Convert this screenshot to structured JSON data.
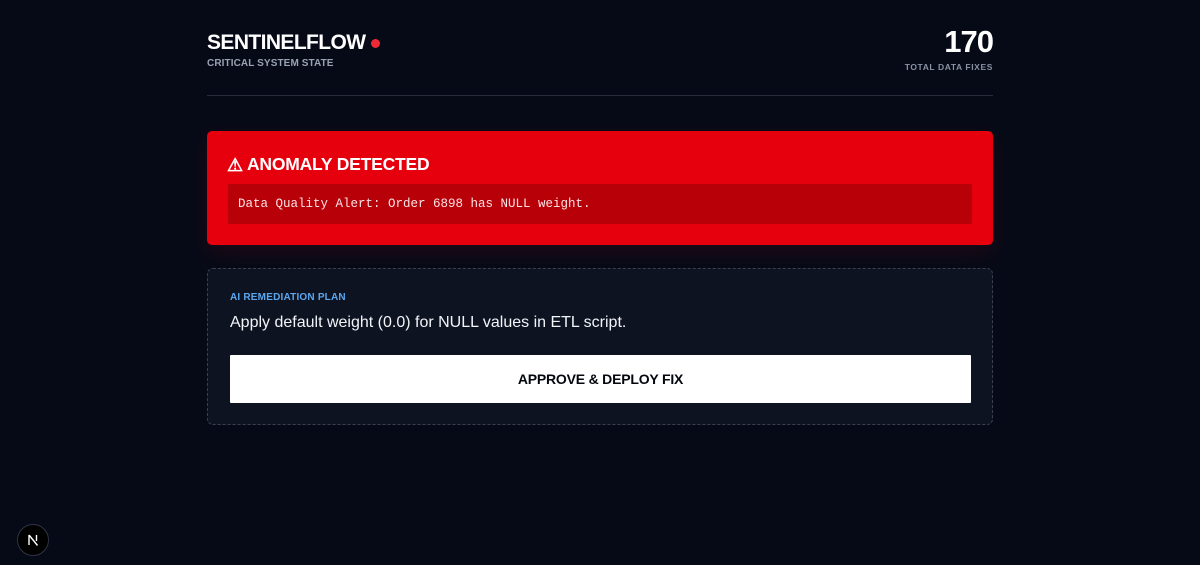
{
  "header": {
    "brand_name": "SENTINELFLOW",
    "brand_subtitle": "CRITICAL SYSTEM STATE",
    "status_dot_color": "#ef2a36",
    "total_fixes_value": "170",
    "total_fixes_label": "TOTAL DATA FIXES"
  },
  "alert": {
    "icon": "warning-icon",
    "icon_glyph": "⚠",
    "title": "ANOMALY DETECTED",
    "message": "Data Quality Alert: Order 6898 has NULL weight.",
    "accent_color": "#e6000d"
  },
  "plan": {
    "label": "AI REMEDIATION PLAN",
    "text": "Apply default weight (0.0) for NULL values in ETL script.",
    "button_label": "APPROVE & DEPLOY FIX",
    "label_color": "#5aa7ef"
  },
  "dev_badge": {
    "icon": "nextjs-logo-icon"
  }
}
